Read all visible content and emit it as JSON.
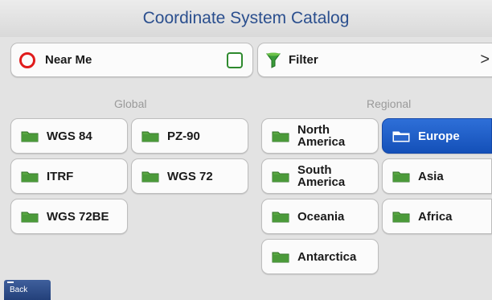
{
  "title": "Coordinate System Catalog",
  "near_me": {
    "label": "Near Me",
    "checked": false
  },
  "filter": {
    "label": "Filter",
    "chevron": ">"
  },
  "global": {
    "label": "Global",
    "items": [
      {
        "label": "WGS 84"
      },
      {
        "label": "PZ-90"
      },
      {
        "label": "ITRF"
      },
      {
        "label": "WGS 72"
      },
      {
        "label": "WGS 72BE"
      }
    ]
  },
  "regional": {
    "label": "Regional",
    "items": [
      {
        "label": "North\nAmerica"
      },
      {
        "label": "Europe",
        "selected": true
      },
      {
        "label": "South\nAmerica"
      },
      {
        "label": "Asia"
      },
      {
        "label": "Oceania"
      },
      {
        "label": "Africa"
      },
      {
        "label": "Antarctica"
      }
    ]
  },
  "back": {
    "label": "Back"
  },
  "colors": {
    "title": "#2b4f8e",
    "selected": "#1a5fcc",
    "folder": "#4a9a3a",
    "near_me_ring": "#e01b1b",
    "checkbox": "#2e8a2e"
  }
}
